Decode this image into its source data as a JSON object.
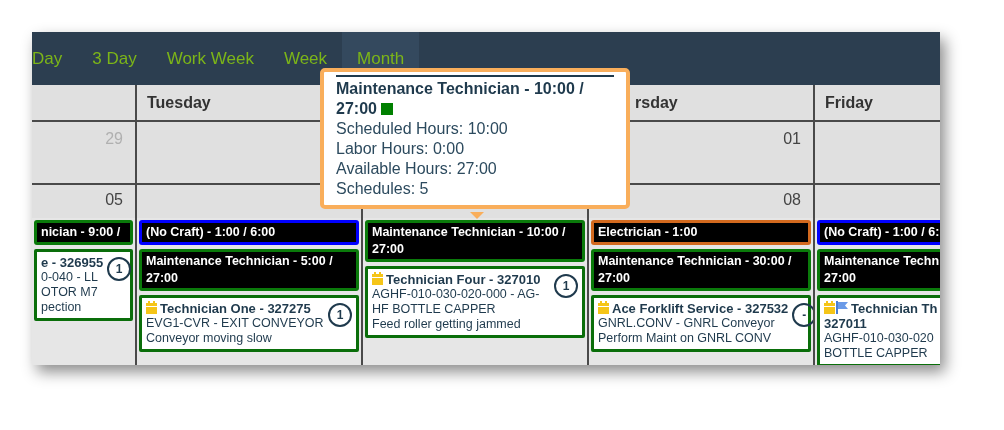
{
  "toolbar": {
    "tabs": [
      {
        "label": "Day",
        "selected": false
      },
      {
        "label": "3 Day",
        "selected": false
      },
      {
        "label": "Work Week",
        "selected": false
      },
      {
        "label": "Week",
        "selected": false
      },
      {
        "label": "Month",
        "selected": true
      }
    ]
  },
  "calendar": {
    "columns": [
      {
        "week_1": {
          "date": "29",
          "muted": true
        },
        "week_2": {
          "date": "05",
          "muted": false,
          "items": [
            {
              "kind": "summary",
              "text": "nician - 9:00 /",
              "color": "#0a7a0a"
            },
            {
              "kind": "work_order",
              "title": "e - 326955",
              "lines": [
                "0-040 - LL",
                "OTOR M7",
                "pection"
              ],
              "badge": "1"
            }
          ]
        }
      },
      {
        "heading": "Tuesday",
        "week_2": {
          "items": [
            {
              "kind": "summary",
              "text": "(No Craft) - 1:00 / 6:00",
              "color": "#0000ff"
            },
            {
              "kind": "summary",
              "text": "Maintenance Technician - 5:00 / 27:00",
              "color": "#0a7a0a"
            },
            {
              "kind": "work_order",
              "title": "Technician One - 327275",
              "lines": [
                "EVG1-CVR - EXIT CONVEYOR",
                "Conveyor moving slow"
              ],
              "badge": "1",
              "scheduled": true,
              "flagged": false
            }
          ]
        }
      },
      {
        "week_2": {
          "items": [
            {
              "kind": "summary",
              "text": "Maintenance Technician - 10:00 / 27:00",
              "color": "#0a7a0a"
            },
            {
              "kind": "work_order",
              "title": "Technician Four - 327010",
              "lines": [
                "AGHF-010-030-020-000 - AG-HF BOTTLE CAPPER",
                "Feed roller getting jammed"
              ],
              "badge": "1",
              "scheduled": true,
              "flagged": false
            }
          ]
        }
      },
      {
        "heading": "rsday",
        "week_1": {
          "date": "01",
          "muted": false
        },
        "week_2": {
          "date": "08",
          "muted": false,
          "items": [
            {
              "kind": "summary",
              "text": "Electrician - 1:00",
              "color": "#d2691e"
            },
            {
              "kind": "summary",
              "text": "Maintenance Technician - 30:00 / 27:00",
              "color": "#0a7a0a"
            },
            {
              "kind": "work_order",
              "title": "Ace Forklift Service - 327532",
              "lines": [
                "GNRL.CONV - GNRL Conveyor",
                "Perform Maint on GNRL CONV"
              ],
              "badge": "-",
              "scheduled": true,
              "flagged": false
            }
          ]
        }
      },
      {
        "heading": "Friday",
        "week_2": {
          "items": [
            {
              "kind": "summary",
              "text": "(No Craft) - 1:00 / 6:",
              "color": "#0000ff"
            },
            {
              "kind": "summary",
              "text": "Maintenance Techn\n27:00",
              "color": "#0a7a0a"
            },
            {
              "kind": "work_order",
              "title": "Technician Th\n327011",
              "lines": [
                "AGHF-010-030-020",
                "BOTTLE CAPPER"
              ],
              "scheduled": true,
              "flagged": true
            }
          ]
        }
      }
    ]
  },
  "tooltip": {
    "title": "Maintenance Technician - 10:00 / 27:00",
    "color": "#008000",
    "lines": [
      "Scheduled Hours: 10:00",
      "Labor Hours: 0:00",
      "Available Hours: 27:00",
      "Schedules: 5"
    ]
  }
}
